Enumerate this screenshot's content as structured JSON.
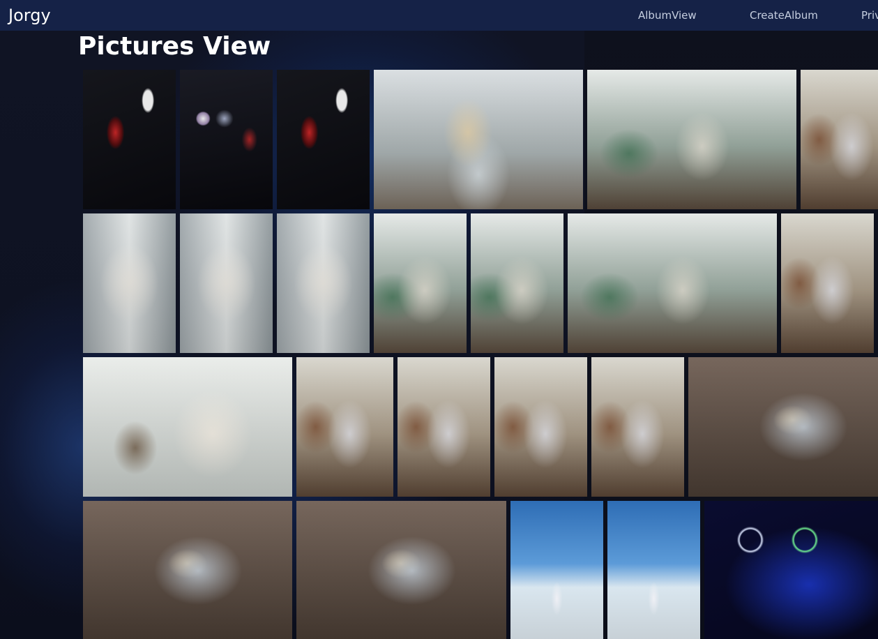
{
  "nav": {
    "brand": "Jorgy",
    "links": [
      "AlbumView",
      "CreateAlbum",
      "Priv"
    ]
  },
  "page": {
    "title": "Pictures View"
  },
  "gallery": {
    "rows": [
      [
        "pc-build-ironman",
        "pc-case-rgb",
        "pc-ironman-fans",
        "painting-portrait",
        "window-garden-portrait",
        "chess-portrait"
      ],
      [
        "window-curtain-1",
        "window-curtain-2",
        "window-curtain-3",
        "sitting-green-room",
        "plant-closeup",
        "window-garden-wide",
        "mirror-floor"
      ],
      [
        "mirror-veil",
        "shelf-standing",
        "shelf-sitting",
        "shelf-closeup",
        "shelf-flowers",
        "floor-lying-1"
      ],
      [
        "floor-lying-2",
        "floor-lying-3",
        "rooftop-sky-1",
        "rooftop-sky-2",
        "pc-blue-fans"
      ]
    ]
  }
}
